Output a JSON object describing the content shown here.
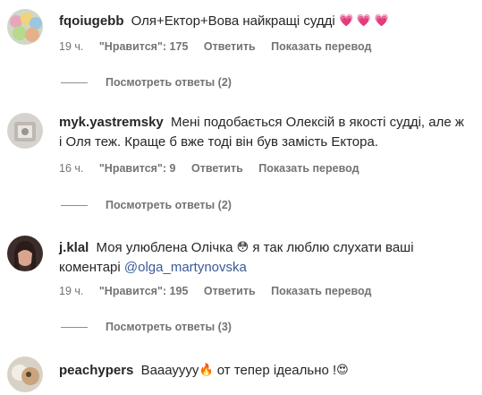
{
  "comments": [
    {
      "username": "fqoiugebb",
      "text": "Оля+Ектор+Вова найкращі судді",
      "emoji": "💗 💗 💗",
      "time": "19 ч.",
      "likes": "\"Нравится\": 175",
      "reply": "Ответить",
      "translate": "Показать перевод",
      "view_replies": "Посмотреть ответы (2)"
    },
    {
      "username": "myk.yastremsky",
      "text": "Мені подобається Олексій в якості судді, але ж і Оля теж. Краще б вже тоді він був замість Ектора.",
      "time": "16 ч.",
      "likes": "\"Нравится\": 9",
      "reply": "Ответить",
      "translate": "Показать перевод",
      "view_replies": "Посмотреть ответы (2)"
    },
    {
      "username": "j.klal",
      "text_before": "Моя улюблена Олічка",
      "emoji": "😳",
      "text_after": "я так люблю слухати ваші коментарі",
      "mention": "@olga_martynovska",
      "time": "19 ч.",
      "likes": "\"Нравится\": 195",
      "reply": "Ответить",
      "translate": "Показать перевод",
      "view_replies": "Посмотреть ответы (3)"
    },
    {
      "username": "peachypers",
      "text_before": "Вааауууу",
      "emoji1": "🔥",
      "text_after": "от тепер ідеально !",
      "emoji2": "😍"
    }
  ]
}
